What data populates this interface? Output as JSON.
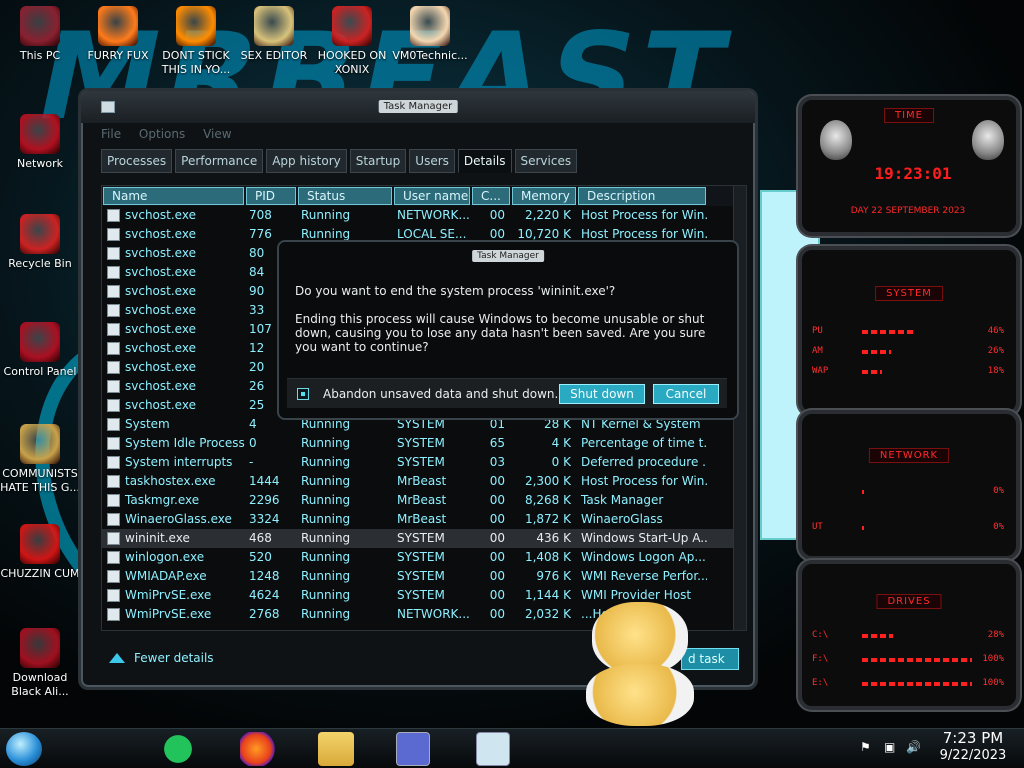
{
  "desktop": {
    "icons": [
      {
        "label": "This PC"
      },
      {
        "label": "FURRY FUX"
      },
      {
        "label": "DONT STICK THIS IN YO..."
      },
      {
        "label": "SEX EDITOR"
      },
      {
        "label": "HOOKED ON XONIX"
      },
      {
        "label": "VM0Technic..."
      },
      {
        "label": "Network"
      },
      {
        "label": "Recycle Bin"
      },
      {
        "label": "Control Panel"
      },
      {
        "label": "COMMUNISTS HATE THIS G..."
      },
      {
        "label": "CHUZZIN CUM"
      },
      {
        "label": "Download Black Ali..."
      }
    ]
  },
  "task_manager": {
    "title": "Task Manager",
    "menu": [
      "File",
      "Options",
      "View"
    ],
    "tabs": [
      "Processes",
      "Performance",
      "App history",
      "Startup",
      "Users",
      "Details",
      "Services"
    ],
    "active_tab": "Details",
    "columns": [
      "Name",
      "PID",
      "Status",
      "User name",
      "C...",
      "Memory ...",
      "Description"
    ],
    "rows": [
      {
        "name": "svchost.exe",
        "pid": "708",
        "status": "Running",
        "user": "NETWORK...",
        "cpu": "00",
        "mem": "2,220 K",
        "desc": "Host Process for Win..."
      },
      {
        "name": "svchost.exe",
        "pid": "776",
        "status": "Running",
        "user": "LOCAL SE...",
        "cpu": "00",
        "mem": "10,720 K",
        "desc": "Host Process for Win..."
      },
      {
        "name": "svchost.exe",
        "pid": "80",
        "status": "",
        "user": "",
        "cpu": "",
        "mem": "",
        "desc": ""
      },
      {
        "name": "svchost.exe",
        "pid": "84",
        "status": "",
        "user": "",
        "cpu": "",
        "mem": "",
        "desc": ""
      },
      {
        "name": "svchost.exe",
        "pid": "90",
        "status": "",
        "user": "",
        "cpu": "",
        "mem": "",
        "desc": ""
      },
      {
        "name": "svchost.exe",
        "pid": "33",
        "status": "",
        "user": "",
        "cpu": "",
        "mem": "",
        "desc": ""
      },
      {
        "name": "svchost.exe",
        "pid": "107",
        "status": "",
        "user": "",
        "cpu": "",
        "mem": "",
        "desc": ""
      },
      {
        "name": "svchost.exe",
        "pid": "12",
        "status": "",
        "user": "",
        "cpu": "",
        "mem": "",
        "desc": ""
      },
      {
        "name": "svchost.exe",
        "pid": "20",
        "status": "",
        "user": "",
        "cpu": "",
        "mem": "",
        "desc": ""
      },
      {
        "name": "svchost.exe",
        "pid": "26",
        "status": "",
        "user": "",
        "cpu": "",
        "mem": "",
        "desc": ""
      },
      {
        "name": "svchost.exe",
        "pid": "25",
        "status": "",
        "user": "",
        "cpu": "",
        "mem": "",
        "desc": ""
      },
      {
        "name": "System",
        "pid": "4",
        "status": "Running",
        "user": "SYSTEM",
        "cpu": "01",
        "mem": "28 K",
        "desc": "NT Kernel & System"
      },
      {
        "name": "System Idle Process",
        "pid": "0",
        "status": "Running",
        "user": "SYSTEM",
        "cpu": "65",
        "mem": "4 K",
        "desc": "Percentage of time t..."
      },
      {
        "name": "System interrupts",
        "pid": "-",
        "status": "Running",
        "user": "SYSTEM",
        "cpu": "03",
        "mem": "0 K",
        "desc": "Deferred procedure ..."
      },
      {
        "name": "taskhostex.exe",
        "pid": "1444",
        "status": "Running",
        "user": "MrBeast",
        "cpu": "00",
        "mem": "2,300 K",
        "desc": "Host Process for Win..."
      },
      {
        "name": "Taskmgr.exe",
        "pid": "2296",
        "status": "Running",
        "user": "MrBeast",
        "cpu": "00",
        "mem": "8,268 K",
        "desc": "Task Manager"
      },
      {
        "name": "WinaeroGlass.exe",
        "pid": "3324",
        "status": "Running",
        "user": "MrBeast",
        "cpu": "00",
        "mem": "1,872 K",
        "desc": "WinaeroGlass"
      },
      {
        "name": "wininit.exe",
        "pid": "468",
        "status": "Running",
        "user": "SYSTEM",
        "cpu": "00",
        "mem": "436 K",
        "desc": "Windows Start-Up A..."
      },
      {
        "name": "winlogon.exe",
        "pid": "520",
        "status": "Running",
        "user": "SYSTEM",
        "cpu": "00",
        "mem": "1,408 K",
        "desc": "Windows Logon Ap..."
      },
      {
        "name": "WMIADAP.exe",
        "pid": "1248",
        "status": "Running",
        "user": "SYSTEM",
        "cpu": "00",
        "mem": "976 K",
        "desc": "WMI Reverse Perfor..."
      },
      {
        "name": "WmiPrvSE.exe",
        "pid": "4624",
        "status": "Running",
        "user": "SYSTEM",
        "cpu": "00",
        "mem": "1,144 K",
        "desc": "WMI Provider Host"
      },
      {
        "name": "WmiPrvSE.exe",
        "pid": "2768",
        "status": "Running",
        "user": "NETWORK...",
        "cpu": "00",
        "mem": "2,032 K",
        "desc": "...Host"
      }
    ],
    "selected_row": "wininit.exe",
    "fewer_details": "Fewer details",
    "end_task": "d task"
  },
  "dialog": {
    "title": "Task Manager",
    "question": "Do you want to end the system process 'wininit.exe'?",
    "body": "Ending this process will cause Windows to become unusable or shut down, causing you to lose any data hasn't been saved. Are you sure you want to continue?",
    "checkbox_label": "Abandon unsaved data and shut down.",
    "checkbox_checked": true,
    "shutdown_label": "Shut down",
    "cancel_label": "Cancel"
  },
  "gadgets": {
    "time": {
      "title": "TIME",
      "clock": "19:23:01",
      "date": "DAY 22 SEPTEMBER 2023"
    },
    "system": {
      "title": "SYSTEM",
      "rows": [
        {
          "label": "PU",
          "value": "46%"
        },
        {
          "label": "AM",
          "value": "26%"
        },
        {
          "label": "WAP",
          "value": "18%"
        }
      ]
    },
    "network": {
      "title": "NETWORK",
      "rows": [
        {
          "label": "",
          "value": "0%"
        },
        {
          "label": "UT",
          "value": "0%"
        }
      ]
    },
    "drives": {
      "title": "DRIVES",
      "rows": [
        {
          "label": "C:\\",
          "value": "28%"
        },
        {
          "label": "F:\\",
          "value": "100%"
        },
        {
          "label": "E:\\",
          "value": "100%"
        }
      ]
    }
  },
  "taskbar": {
    "time": "7:23 PM",
    "date": "9/22/2023"
  },
  "colors": {
    "accent": "#2aa9c2",
    "gadget_red": "#ff2a2a"
  }
}
